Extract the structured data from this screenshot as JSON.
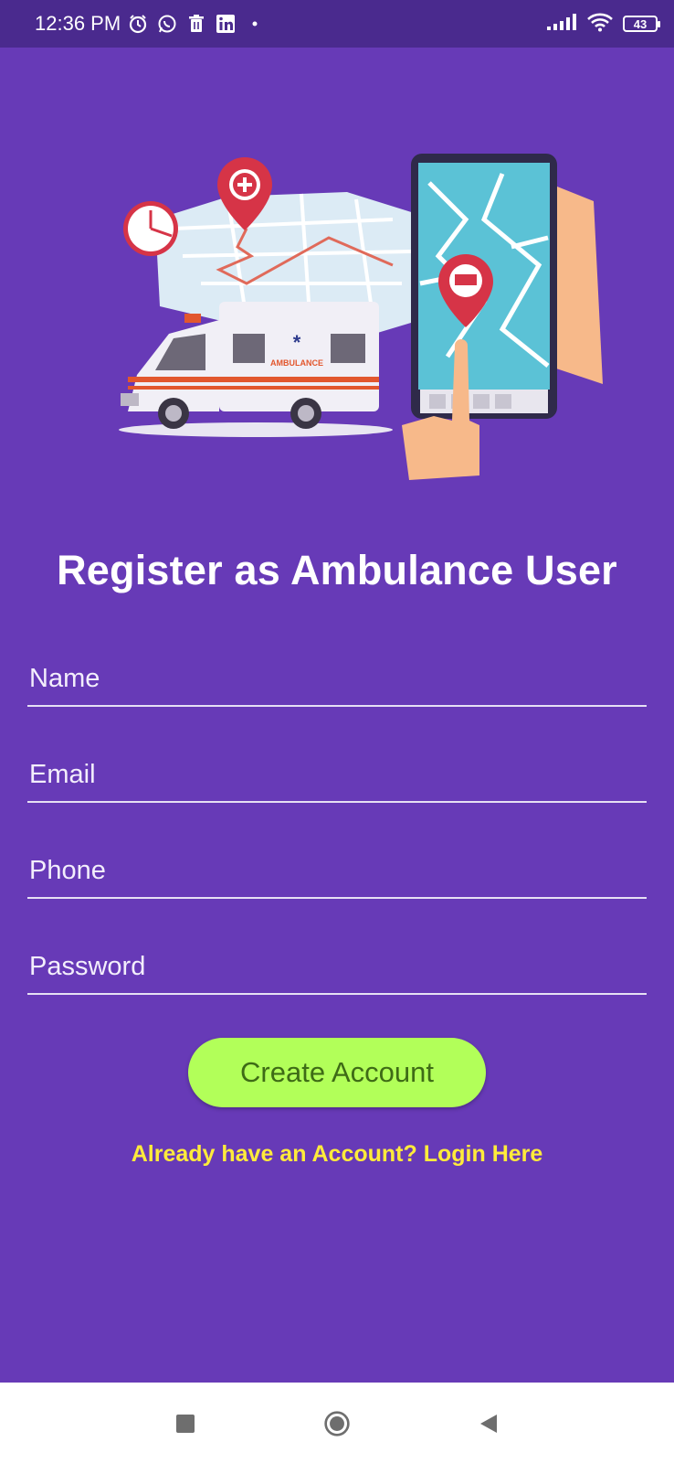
{
  "status_bar": {
    "time": "12:36 PM",
    "battery": "43",
    "icons": [
      "alarm-icon",
      "whatsapp-icon",
      "trash-icon",
      "linkedin-icon",
      "dot-icon",
      "signal-icon",
      "wifi-icon",
      "battery-icon"
    ]
  },
  "illustration": {
    "ambulance_label": "AMBULANCE"
  },
  "form": {
    "title": "Register as Ambulance User",
    "name_placeholder": "Name",
    "email_placeholder": "Email",
    "phone_placeholder": "Phone",
    "password_placeholder": "Password",
    "submit_label": "Create Account",
    "login_link": "Already have an Account? Login Here"
  },
  "nav_bar": {
    "icons": [
      "recents-icon",
      "home-icon",
      "back-icon"
    ]
  },
  "colors": {
    "background": "#673AB7",
    "status_bar": "#4A2A8E",
    "button": "#B2FF59",
    "button_text": "#3E6B16",
    "link": "#FFEB3B"
  }
}
